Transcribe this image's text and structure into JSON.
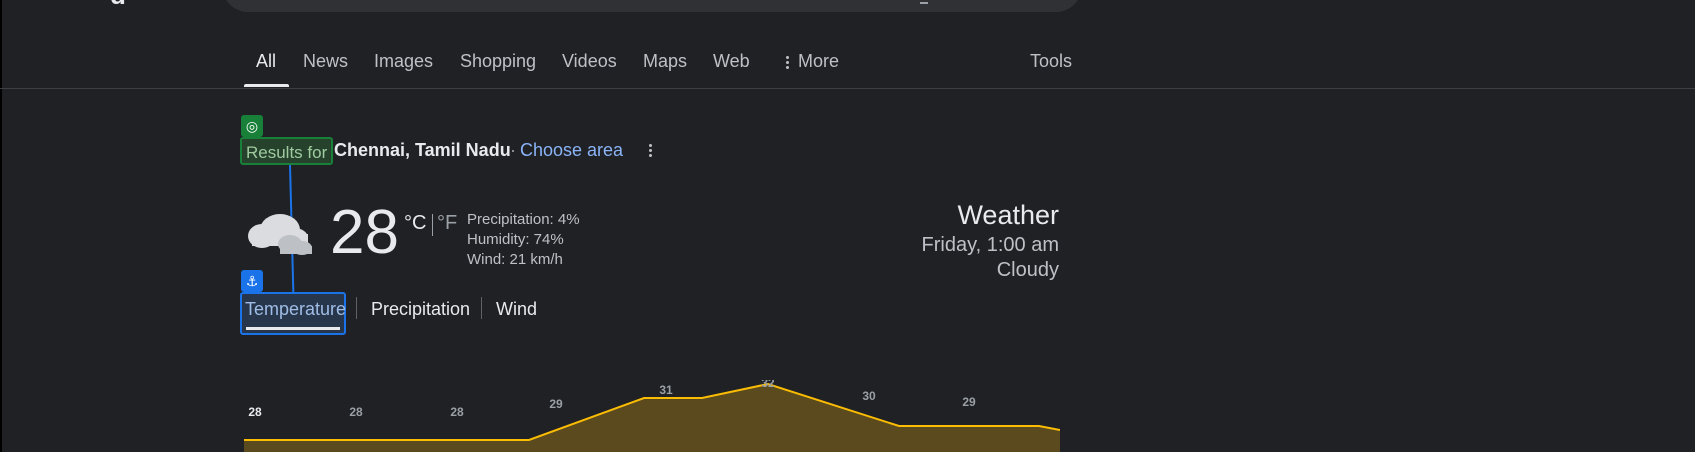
{
  "tabs": [
    {
      "label": "All",
      "active": true
    },
    {
      "label": "News"
    },
    {
      "label": "Images"
    },
    {
      "label": "Shopping"
    },
    {
      "label": "Videos"
    },
    {
      "label": "Maps"
    },
    {
      "label": "Web"
    },
    {
      "label": "More"
    }
  ],
  "tools_label": "Tools",
  "results": {
    "prefix": "Results for",
    "location": "Chennai, Tamil Nadu",
    "separator": "·",
    "choose_area": "Choose area"
  },
  "weather": {
    "temperature": "28",
    "unit_c": "°C",
    "unit_f": "°F",
    "precipitation": "Precipitation: 4%",
    "humidity": "Humidity: 74%",
    "wind": "Wind: 21 km/h",
    "title": "Weather",
    "datetime": "Friday, 1:00 am",
    "condition": "Cloudy",
    "icon": "cloudy-icon"
  },
  "subtabs": [
    "Temperature",
    "Precipitation",
    "Wind"
  ],
  "annotation_icons": {
    "green": "target-icon",
    "blue": "anchor-icon"
  },
  "colors": {
    "line": "#fbbc04",
    "fill": "#5b4a1e",
    "green": "#188038",
    "blue": "#1a73e8"
  },
  "chart_data": {
    "type": "area",
    "title": "",
    "values": [
      28,
      28,
      28,
      29,
      31,
      32,
      30,
      29,
      28
    ],
    "labels": [
      "28",
      "28",
      "28",
      "29",
      "31",
      "32",
      "30",
      "29",
      ""
    ],
    "ylim": [
      24,
      34
    ],
    "grid": false
  }
}
